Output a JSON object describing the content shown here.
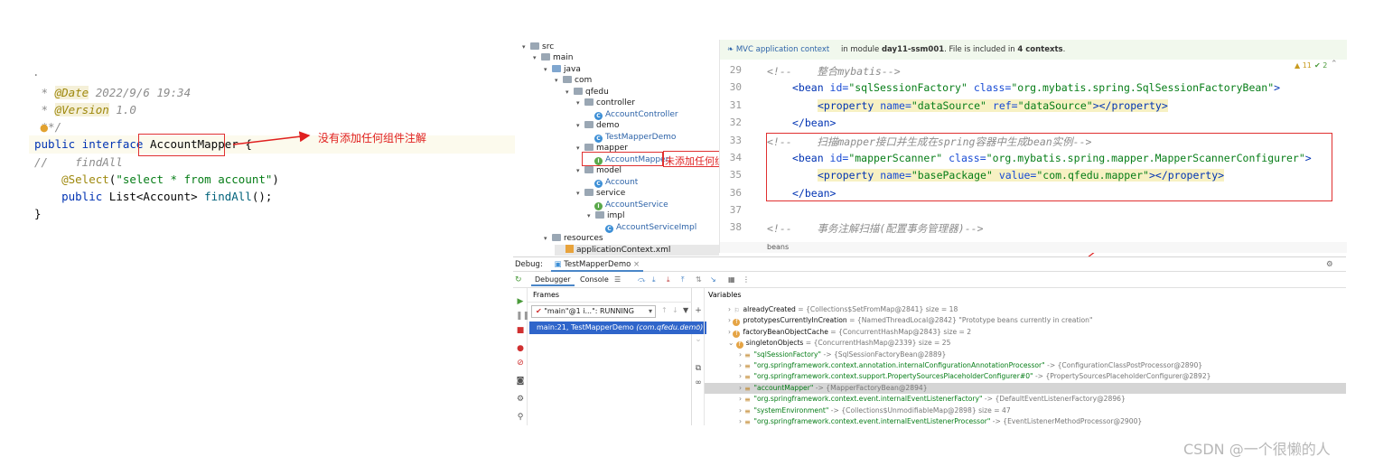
{
  "left_code": {
    "dot": ".",
    "date_prefix": " * ",
    "date_tag": "@Date",
    "date_value": " 2022/9/6 19:34",
    "version_prefix": " * ",
    "version_tag": "@Version",
    "version_value": " 1.0",
    "comment_end": " **/",
    "line_public": "public",
    "line_interface": " interface ",
    "class_name": "AccountMapper",
    "brace_open": " {",
    "commented_find": "//    findAll",
    "select_ann": "@Select",
    "select_paren_open": "(",
    "select_string": "\"select * from account\"",
    "select_paren_close": ")",
    "method_public": "public",
    "method_rest": " List<Account> ",
    "method_name": "findAll",
    "method_end": "();",
    "brace_close": "}",
    "annotation_note": "没有添加任何组件注解"
  },
  "tree": {
    "items": [
      {
        "label": "src",
        "icon": "folder"
      },
      {
        "label": "main",
        "icon": "folder"
      },
      {
        "label": "java",
        "icon": "folder-blue"
      },
      {
        "label": "com",
        "icon": "folder"
      },
      {
        "label": "qfedu",
        "icon": "folder"
      },
      {
        "label": "controller",
        "icon": "folder"
      },
      {
        "label": "AccountController",
        "icon": "class"
      },
      {
        "label": "demo",
        "icon": "folder"
      },
      {
        "label": "TestMapperDemo",
        "icon": "class"
      },
      {
        "label": "mapper",
        "icon": "folder"
      },
      {
        "label": "AccountMapper",
        "icon": "interface"
      },
      {
        "label": "model",
        "icon": "folder"
      },
      {
        "label": "Account",
        "icon": "class"
      },
      {
        "label": "service",
        "icon": "folder"
      },
      {
        "label": "AccountService",
        "icon": "interface"
      },
      {
        "label": "impl",
        "icon": "folder"
      },
      {
        "label": "AccountServiceImpl",
        "icon": "class"
      },
      {
        "label": "resources",
        "icon": "folder"
      },
      {
        "label": "applicationContext.xml",
        "icon": "xml"
      }
    ],
    "mapper_note": "未添加任何组件注解"
  },
  "xml_editor": {
    "context_link": "MVC application context",
    "context_text_1": "in module ",
    "context_module": "day11-ssm001",
    "context_text_2": ". File is included in ",
    "context_count": "4 contexts",
    "context_text_3": ".",
    "warnings": "▲ 11",
    "checks": "✔ 2",
    "line_numbers": [
      "29",
      "30",
      "31",
      "32",
      "33",
      "34",
      "35",
      "36",
      "37",
      "38"
    ],
    "cmt_integrate": "<!--    整合mybatis-->",
    "bean1_open": "<bean ",
    "bean1_id_attr": "id=",
    "bean1_id": "\"sqlSessionFactory\"",
    "bean1_class_attr": " class=",
    "bean1_class": "\"org.mybatis.spring.SqlSessionFactoryBean\"",
    "bean1_close": ">",
    "prop1_open": "<property ",
    "prop1_name_attr": "name=",
    "prop1_name": "\"dataSource\"",
    "prop1_ref_attr": " ref=",
    "prop1_ref": "\"dataSource\"",
    "prop1_close": "></property>",
    "bean_end": "</bean>",
    "cmt_scan": "<!--    扫描mapper接口并生成在spring容器中生成bean实例-->",
    "bean2_open": "<bean ",
    "bean2_id_attr": "id=",
    "bean2_id": "\"mapperScanner\"",
    "bean2_class_attr": " class=",
    "bean2_class": "\"org.mybatis.spring.mapper.MapperScannerConfigurer\"",
    "bean2_close": ">",
    "prop2_open": "<property ",
    "prop2_name_attr": "name=",
    "prop2_name": "\"basePackage\"",
    "prop2_value_attr": " value=",
    "prop2_value": "\"com.qfedu.mapper\"",
    "prop2_close": "></property>",
    "bean2_end": "</bean>",
    "cmt_tx": "<!--    事务注解扫描(配置事务管理器)-->",
    "breadcrumb": "beans"
  },
  "debug": {
    "label": "Debug:",
    "tab": "TestMapperDemo",
    "tab_debugger": "Debugger",
    "tab_console": "Console",
    "frames_title": "Frames",
    "thread": "\"main\"@1 i...\": RUNNING",
    "frame": "main:21, TestMapperDemo",
    "frame_pkg": "(com.qfedu.demo)",
    "variables_title": "Variables",
    "vars": [
      {
        "name": "alreadyCreated",
        "value": " = {Collections$SetFromMap@2841}  size = 18",
        "icon": "flag",
        "indent": 0
      },
      {
        "name": "prototypesCurrentlyInCreation",
        "value": " = {NamedThreadLocal@2842} \"Prototype beans currently in creation\"",
        "icon": "f",
        "indent": 0
      },
      {
        "name": "factoryBeanObjectCache",
        "value": " = {ConcurrentHashMap@2843}  size = 2",
        "icon": "f",
        "indent": 0
      },
      {
        "name": "singletonObjects",
        "value": " = {ConcurrentHashMap@2339}  size = 25",
        "icon": "f",
        "indent": 0
      },
      {
        "name": "\"sqlSessionFactory\"",
        "value": " -> {SqlSessionFactoryBean@2889}",
        "icon": "list",
        "indent": 1
      },
      {
        "name": "\"org.springframework.context.annotation.internalConfigurationAnnotationProcessor\"",
        "value": " -> {ConfigurationClassPostProcessor@2890}",
        "icon": "list",
        "indent": 1
      },
      {
        "name": "\"org.springframework.context.support.PropertySourcesPlaceholderConfigurer#0\"",
        "value": " -> {PropertySourcesPlaceholderConfigurer@2892}",
        "icon": "list",
        "indent": 1
      },
      {
        "name": "\"accountMapper\"",
        "value": " -> {MapperFactoryBean@2894}",
        "icon": "list",
        "indent": 1,
        "selected": true
      },
      {
        "name": "\"org.springframework.context.event.internalEventListenerFactory\"",
        "value": " -> {DefaultEventListenerFactory@2896}",
        "icon": "list",
        "indent": 1
      },
      {
        "name": "\"systemEnvironment\"",
        "value": " -> {Collections$UnmodifiableMap@2898}  size = 47",
        "icon": "list",
        "indent": 1
      },
      {
        "name": "\"org.springframework.context.event.internalEventListenerProcessor\"",
        "value": " -> {EventListenerMethodProcessor@2900}",
        "icon": "list",
        "indent": 1
      }
    ]
  },
  "watermark": "CSDN @一个很懒的人",
  "colors": {
    "annotation_red": "#e02020",
    "selection_blue": "#2f65ca"
  }
}
